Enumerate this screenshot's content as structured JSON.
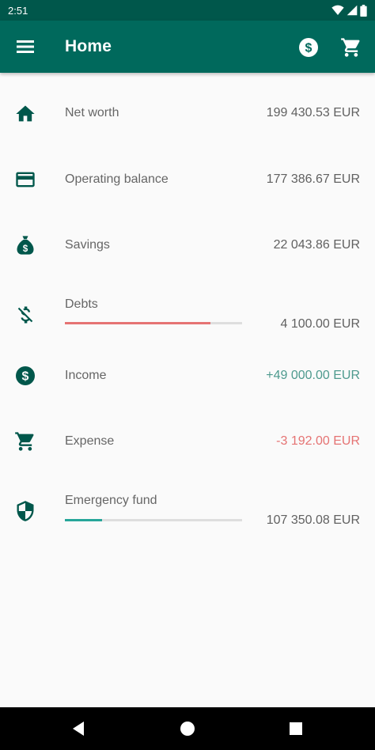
{
  "status_bar": {
    "time": "2:51"
  },
  "app_bar": {
    "title": "Home"
  },
  "rows": {
    "net_worth": {
      "label": "Net worth",
      "value": "199 430.53 EUR"
    },
    "operating_balance": {
      "label": "Operating balance",
      "value": "177 386.67 EUR"
    },
    "savings": {
      "label": "Savings",
      "value": "22 043.86 EUR"
    },
    "debts": {
      "label": "Debts",
      "value": "4 100.00 EUR",
      "progress": 0.82
    },
    "income": {
      "label": "Income",
      "value": "+49 000.00 EUR"
    },
    "expense": {
      "label": "Expense",
      "value": "-3 192.00 EUR"
    },
    "emergency_fund": {
      "label": "Emergency fund",
      "value": "107 350.08 EUR",
      "progress": 0.21
    }
  },
  "colors": {
    "status_bar": "#00574b",
    "app_bar": "#00695c",
    "icon": "#00574b",
    "positive": "#4e9a8e",
    "negative": "#e57373",
    "debts_bar": "#e57373",
    "emergency_bar": "#26a69a"
  }
}
